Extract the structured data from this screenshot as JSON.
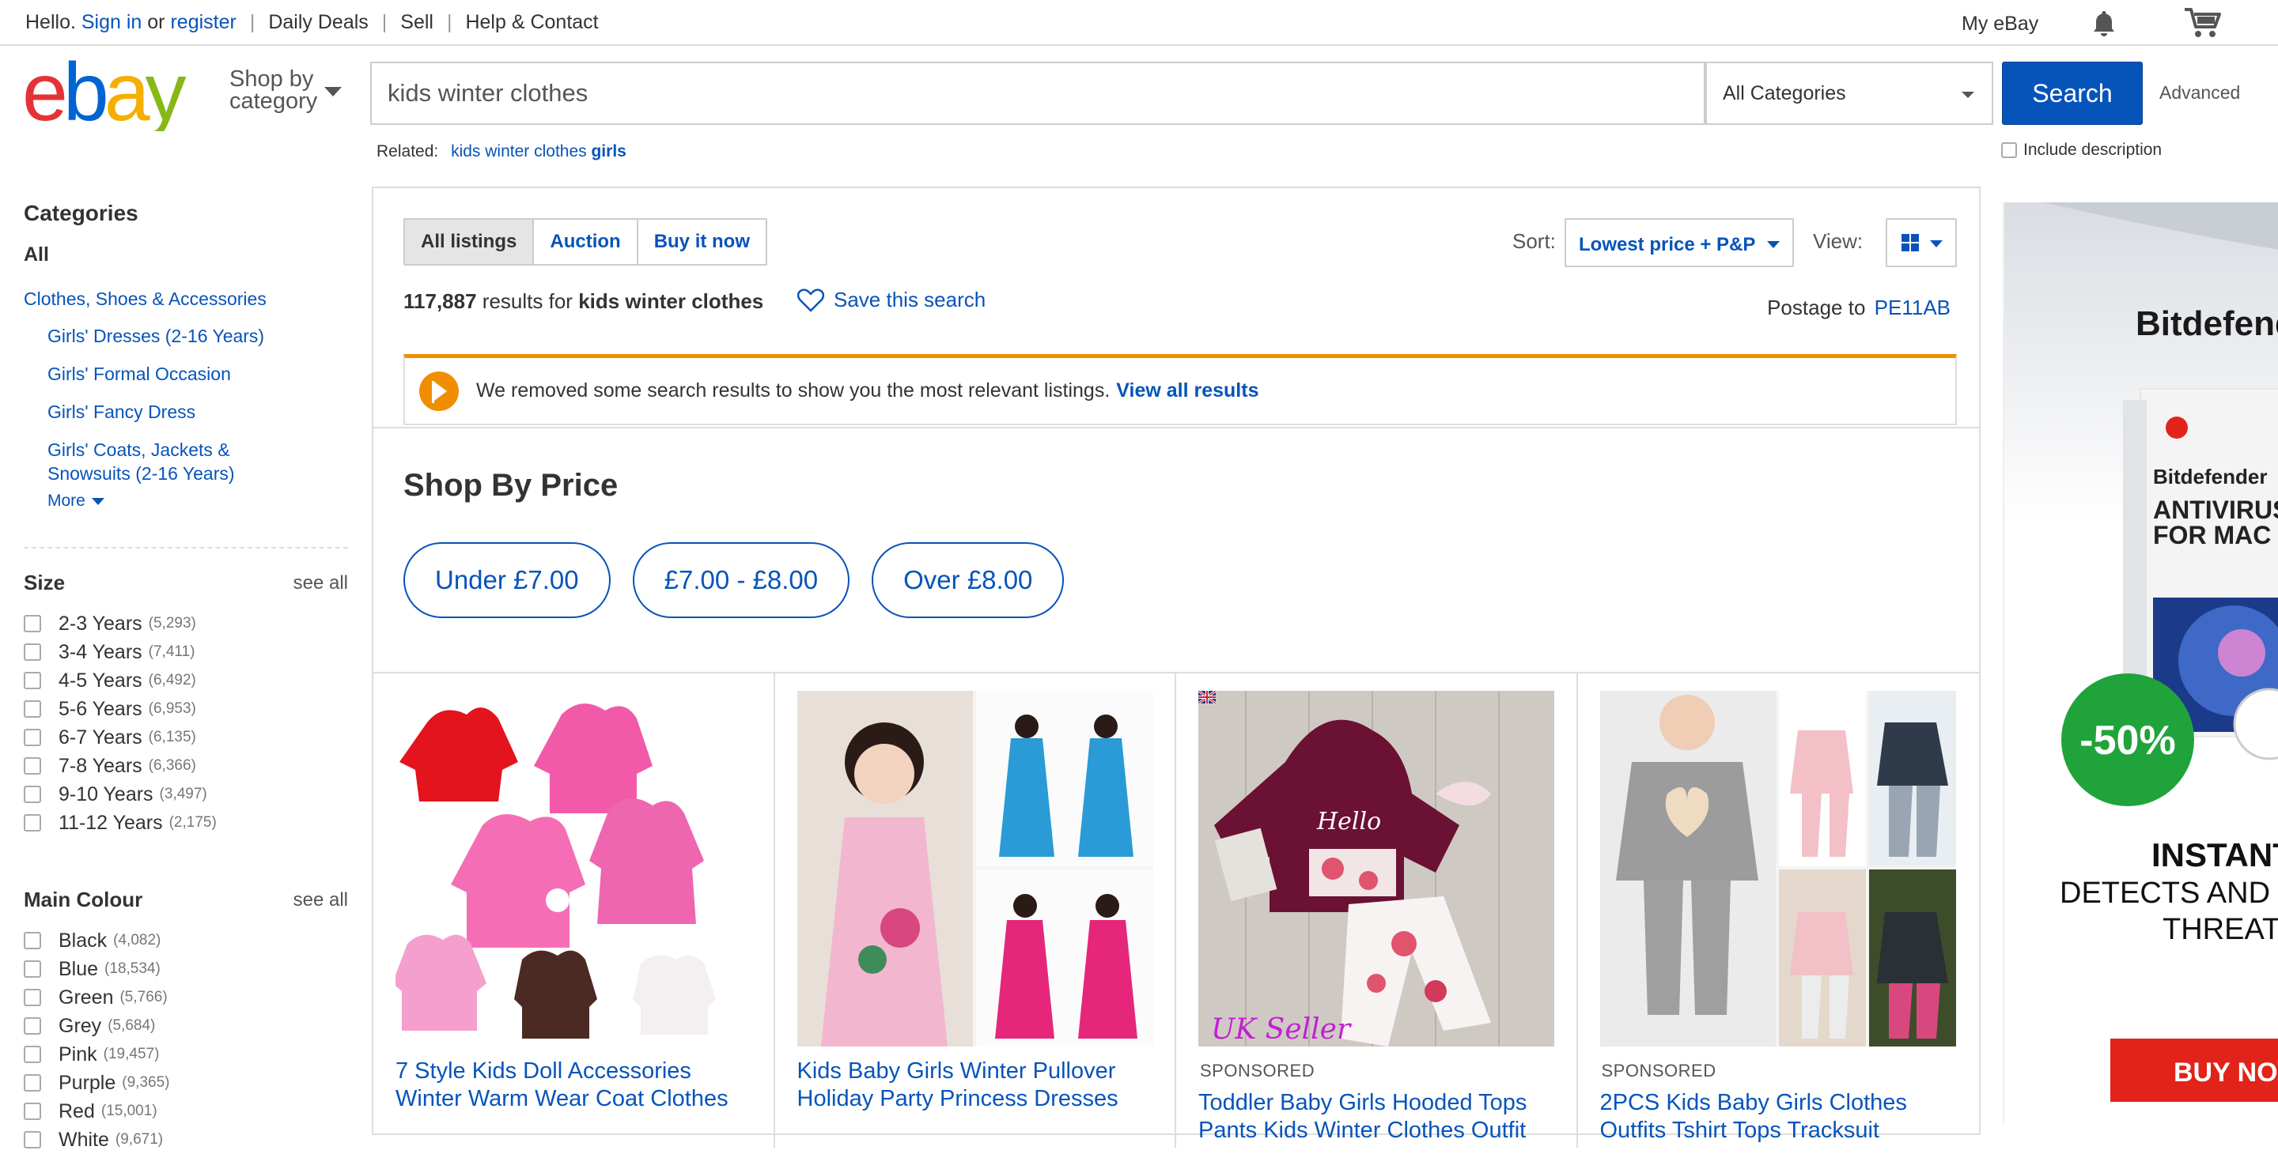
{
  "topbar": {
    "greeting": "Hello.",
    "sign_in": "Sign in",
    "or": "or",
    "register": "register",
    "daily_deals": "Daily Deals",
    "sell": "Sell",
    "help_contact": "Help & Contact",
    "my_ebay": "My eBay",
    "separator": "|"
  },
  "header": {
    "shop_by_line1": "Shop by",
    "shop_by_line2": "category",
    "search_value": "kids winter clothes",
    "category_select": "All Categories",
    "search_button": "Search",
    "advanced": "Advanced",
    "related_label": "Related:",
    "related_link_text": "kids winter clothes",
    "related_link_bold": "girls",
    "include_description": "Include description"
  },
  "sidebar": {
    "categories_title": "Categories",
    "all": "All",
    "top_category": "Clothes, Shoes & Accessories",
    "subcategories": [
      "Girls' Dresses (2-16 Years)",
      "Girls' Formal Occasion",
      "Girls' Fancy Dress",
      "Girls' Coats, Jackets & Snowsuits (2-16 Years)"
    ],
    "more": "More",
    "size": {
      "title": "Size",
      "see_all": "see all",
      "items": [
        {
          "label": "2-3 Years",
          "count": "(5,293)"
        },
        {
          "label": "3-4 Years",
          "count": "(7,411)"
        },
        {
          "label": "4-5 Years",
          "count": "(6,492)"
        },
        {
          "label": "5-6 Years",
          "count": "(6,953)"
        },
        {
          "label": "6-7 Years",
          "count": "(6,135)"
        },
        {
          "label": "7-8 Years",
          "count": "(6,366)"
        },
        {
          "label": "9-10 Years",
          "count": "(3,497)"
        },
        {
          "label": "11-12 Years",
          "count": "(2,175)"
        }
      ]
    },
    "colour": {
      "title": "Main Colour",
      "see_all": "see all",
      "items": [
        {
          "label": "Black",
          "count": "(4,082)"
        },
        {
          "label": "Blue",
          "count": "(18,534)"
        },
        {
          "label": "Green",
          "count": "(5,766)"
        },
        {
          "label": "Grey",
          "count": "(5,684)"
        },
        {
          "label": "Pink",
          "count": "(19,457)"
        },
        {
          "label": "Purple",
          "count": "(9,365)"
        },
        {
          "label": "Red",
          "count": "(15,001)"
        },
        {
          "label": "White",
          "count": "(9,671)"
        }
      ]
    }
  },
  "results": {
    "tabs": [
      "All listings",
      "Auction",
      "Buy it now"
    ],
    "sort_label": "Sort:",
    "sort_value": "Lowest price + P&P",
    "view_label": "View:",
    "count": "117,887",
    "results_for": "results for",
    "query": "kids winter clothes",
    "save_search": "Save this search",
    "postage_to": "Postage to",
    "postcode": "PE11AB",
    "notice_text": "We removed some search results to show you the most relevant listings.",
    "notice_link": "View all results"
  },
  "shop_by_price": {
    "title": "Shop By Price",
    "buttons": [
      "Under £7.00",
      "£7.00 - £8.00",
      "Over £8.00"
    ]
  },
  "products": [
    {
      "sponsored": "",
      "title_line1": "7 Style Kids Doll Accessories",
      "title_line2": "Winter Warm Wear Coat Clothes"
    },
    {
      "sponsored": "",
      "title_line1": "Kids Baby Girls Winter Pullover",
      "title_line2": "Holiday Party Princess Dresses"
    },
    {
      "sponsored": "SPONSORED",
      "title_line1": "Toddler Baby Girls Hooded Tops",
      "title_line2": "Pants Kids Winter Clothes Outfit",
      "image_caption": "UK Seller"
    },
    {
      "sponsored": "SPONSORED",
      "title_line1": "2PCS Kids Baby Girls Clothes",
      "title_line2": "Outfits Tshirt Tops Tracksuit"
    }
  ],
  "ad": {
    "brand": "Bitdefender",
    "box_brand": "Bitdefender",
    "product_line1": "ANTIVIRUS",
    "product_line2": "FOR MAC",
    "discount": "-50%",
    "headline": "INSTANT",
    "sub1": "DETECTS AND",
    "sub2": "THREATS",
    "cta": "BUY NOW"
  },
  "colors": {
    "link_blue": "#0654ba",
    "notice_orange": "#f18e00",
    "ad_green": "#21a33b",
    "ad_red": "#e2231a"
  }
}
